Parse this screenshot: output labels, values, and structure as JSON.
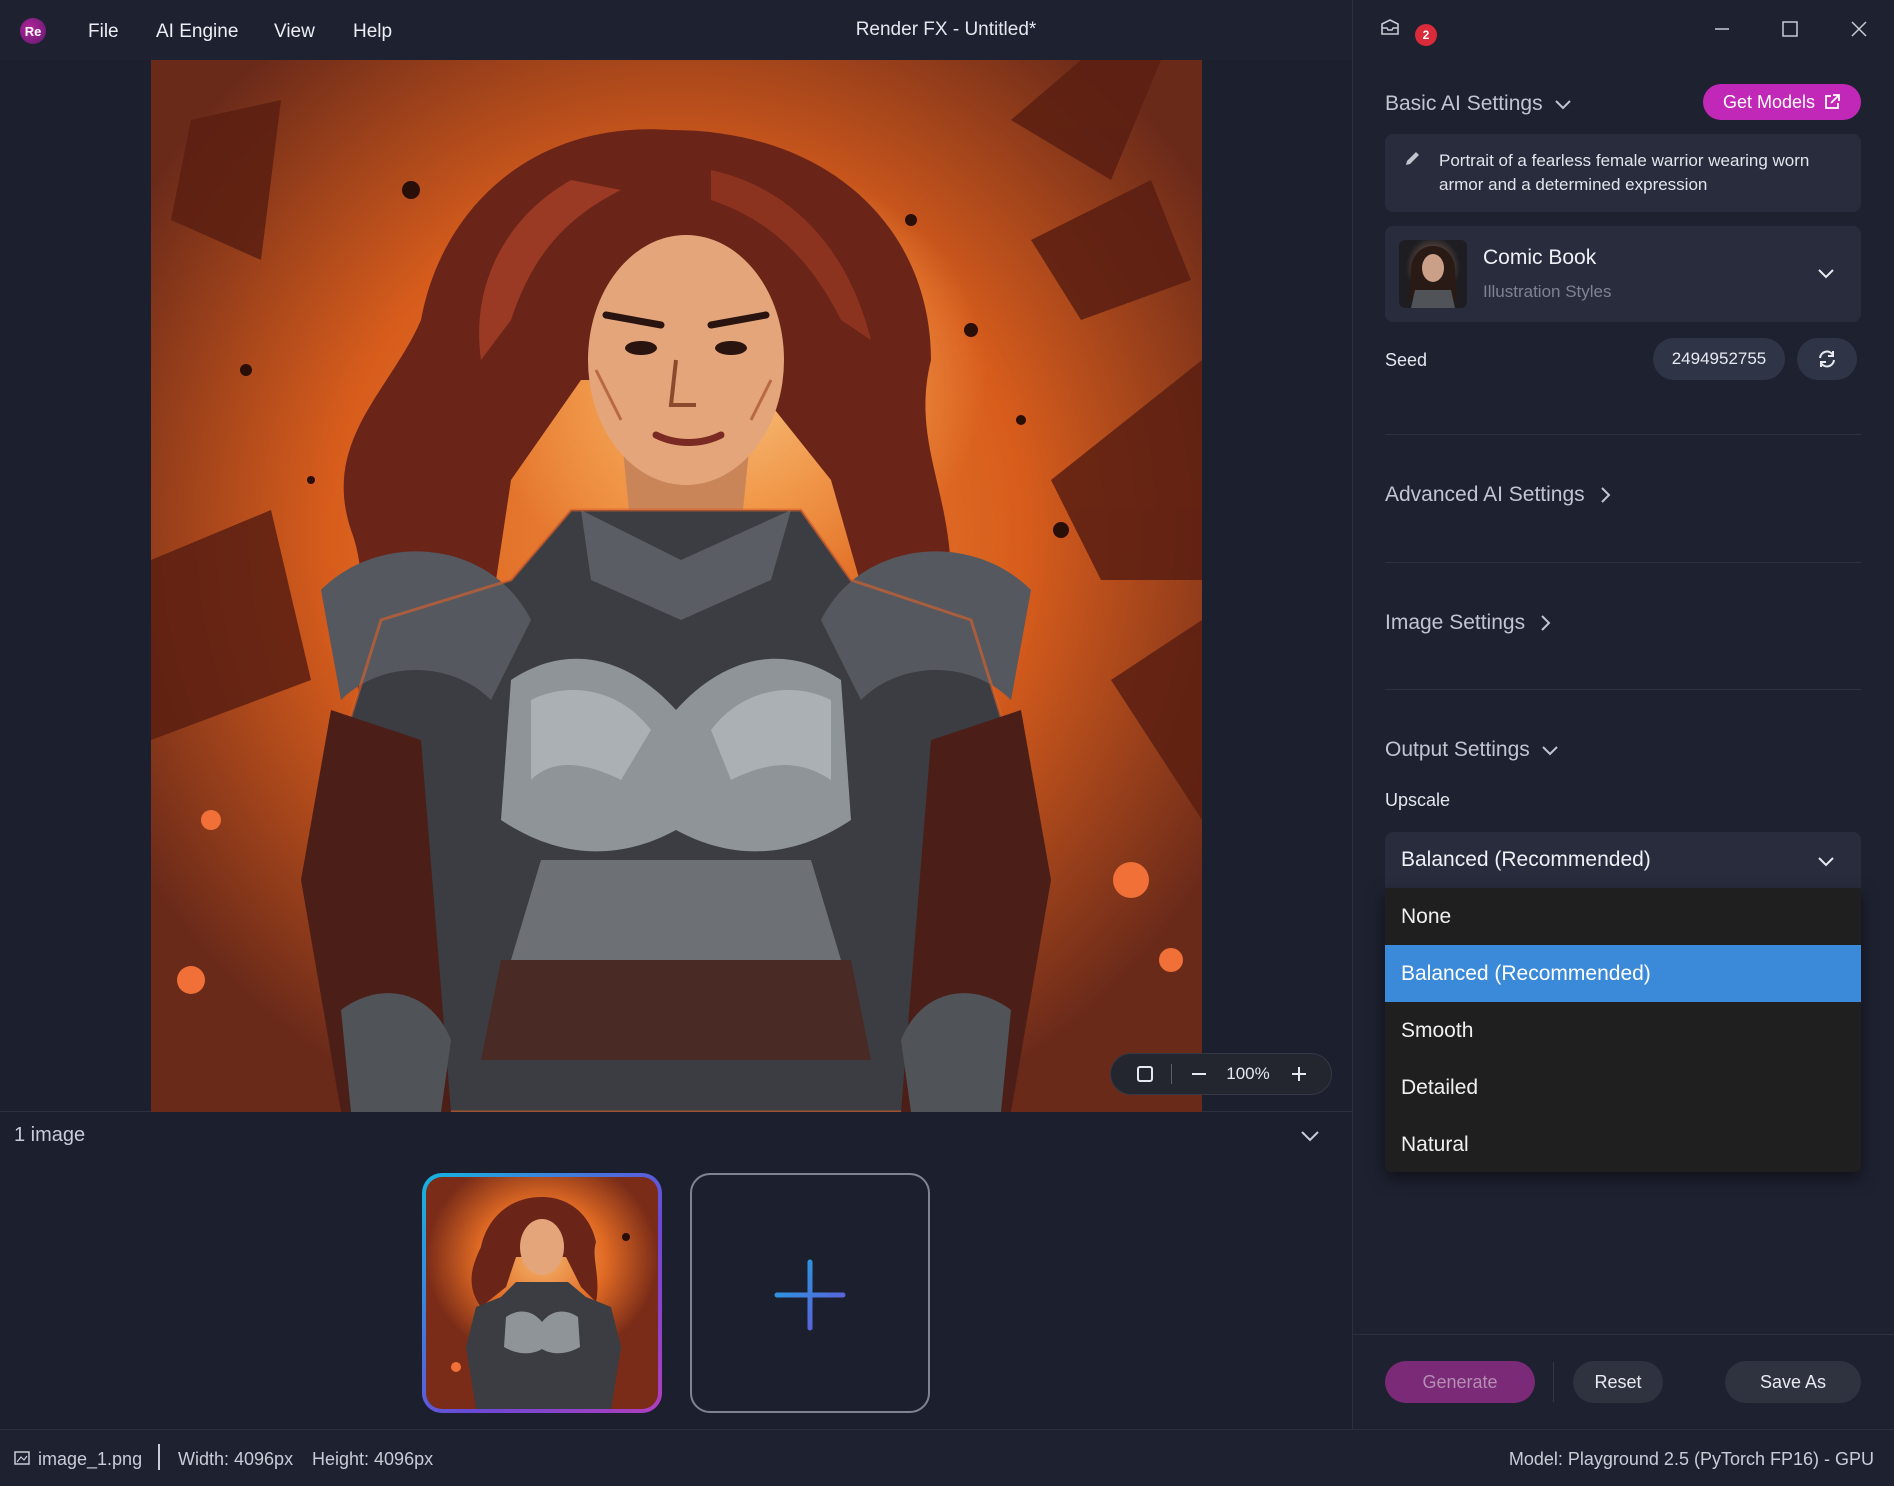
{
  "app": {
    "logo_text": "Re",
    "title": "Render FX - Untitled*",
    "menu": [
      "File",
      "AI Engine",
      "View",
      "Help"
    ],
    "notification_count": "2",
    "brand_color": "#c228b7"
  },
  "canvas": {
    "zoom": "100%"
  },
  "strip": {
    "count_label": "1 image"
  },
  "panel": {
    "basic": {
      "title": "Basic AI Settings",
      "get_models": "Get Models",
      "prompt": "Portrait of a fearless female warrior wearing worn armor and a determined expression",
      "style_name": "Comic Book",
      "style_category": "Illustration Styles",
      "seed_label": "Seed",
      "seed_value": "2494952755"
    },
    "advanced_title": "Advanced AI Settings",
    "image_title": "Image Settings",
    "output": {
      "title": "Output Settings",
      "upscale_label": "Upscale",
      "upscale_value": "Balanced (Recommended)",
      "options": [
        "None",
        "Balanced (Recommended)",
        "Smooth",
        "Detailed",
        "Natural"
      ],
      "selected_index": 1
    },
    "buttons": {
      "generate": "Generate",
      "reset": "Reset",
      "save_as": "Save As"
    }
  },
  "status": {
    "file": "image_1.png",
    "width": "Width: 4096px",
    "height": "Height: 4096px",
    "model": "Model: Playground 2.5 (PyTorch FP16) - GPU"
  },
  "icons": {
    "zoom_fit": "square-icon",
    "zoom_out": "minus-icon",
    "zoom_in": "plus-icon",
    "add_image": "plus-icon",
    "seed_refresh": "refresh-icon",
    "prompt_edit": "pencil-icon",
    "notifications": "inbox-icon"
  }
}
